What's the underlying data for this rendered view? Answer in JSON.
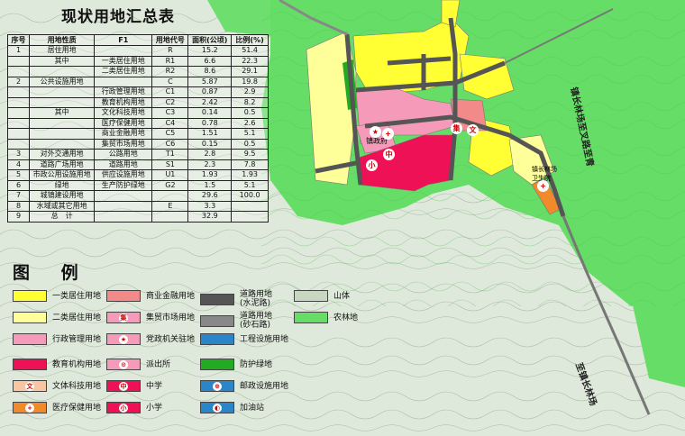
{
  "title": "现状用地汇总表",
  "table": {
    "headers": [
      "序号",
      "用地性质",
      "F1",
      "用地代号",
      "面积(公顷)",
      "比例(%)"
    ],
    "rows": [
      {
        "no": "1",
        "name": "居住用地",
        "sub": "",
        "code": "R",
        "area": "15.2",
        "ratio": "51.4"
      },
      {
        "no": "",
        "name": "其中",
        "sub": "一类居住用地",
        "code": "R1",
        "area": "6.6",
        "ratio": "22.3"
      },
      {
        "no": "",
        "name": "",
        "sub": "二类居住用地",
        "code": "R2",
        "area": "8.6",
        "ratio": "29.1"
      },
      {
        "no": "2",
        "name": "公共设施用地",
        "sub": "",
        "code": "C",
        "area": "5.87",
        "ratio": "19.8"
      },
      {
        "no": "",
        "name": "",
        "sub": "行政管理用地",
        "code": "C1",
        "area": "0.87",
        "ratio": "2.9"
      },
      {
        "no": "",
        "name": "",
        "sub": "教育机构用地",
        "code": "C2",
        "area": "2.42",
        "ratio": "8.2"
      },
      {
        "no": "",
        "name": "其中",
        "sub": "文化科技用地",
        "code": "C3",
        "area": "0.14",
        "ratio": "0.5"
      },
      {
        "no": "",
        "name": "",
        "sub": "医疗保健用地",
        "code": "C4",
        "area": "0.78",
        "ratio": "2.6"
      },
      {
        "no": "",
        "name": "",
        "sub": "商业金融用地",
        "code": "C5",
        "area": "1.51",
        "ratio": "5.1"
      },
      {
        "no": "",
        "name": "",
        "sub": "集贸市场用地",
        "code": "C6",
        "area": "0.15",
        "ratio": "0.5"
      },
      {
        "no": "3",
        "name": "对外交通用地",
        "sub": "公路用地",
        "code": "T1",
        "area": "2.8",
        "ratio": "9.5"
      },
      {
        "no": "4",
        "name": "道路广场用地",
        "sub": "道路用地",
        "code": "S1",
        "area": "2.3",
        "ratio": "7.8"
      },
      {
        "no": "5",
        "name": "市政公用设施用地",
        "sub": "供应设施用地",
        "code": "U1",
        "area": "1.93",
        "ratio": "1.93"
      },
      {
        "no": "6",
        "name": "绿地",
        "sub": "生产防护绿地",
        "code": "G2",
        "area": "1.5",
        "ratio": "5.1"
      },
      {
        "no": "7",
        "name": "城镇建设用地",
        "sub": "",
        "code": "",
        "area": "29.6",
        "ratio": "100.0"
      },
      {
        "no": "8",
        "name": "水域或其它用地",
        "sub": "",
        "code": "E",
        "area": "3.3",
        "ratio": ""
      },
      {
        "no": "9",
        "name": "总　计",
        "sub": "",
        "code": "",
        "area": "32.9",
        "ratio": ""
      }
    ]
  },
  "legend": {
    "title": "图 例",
    "items": [
      {
        "label": "一类居住用地",
        "color": "#ffff33",
        "glyph": ""
      },
      {
        "label": "二类居住用地",
        "color": "#ffff99",
        "glyph": ""
      },
      {
        "label": "行政管理用地",
        "color": "#f59ab8",
        "glyph": ""
      },
      {
        "label": "教育机构用地",
        "color": "#ee1155",
        "glyph": ""
      },
      {
        "label": "文体科技用地",
        "color": "#f8c6a0",
        "glyph": "文"
      },
      {
        "label": "医疗保健用地",
        "color": "#f08a2a",
        "glyph": "+"
      },
      {
        "label": "商业金融用地",
        "color": "#f28a8a",
        "glyph": ""
      },
      {
        "label": "集贸市场用地",
        "color": "#f59ab8",
        "glyph": "集"
      },
      {
        "label": "党政机关驻地",
        "color": "#f59ab8",
        "glyph": "★"
      },
      {
        "label": "派出所",
        "color": "#f59ab8",
        "glyph": "⊙"
      },
      {
        "label": "中学",
        "color": "#ee1155",
        "glyph": "中"
      },
      {
        "label": "小学",
        "color": "#ee1155",
        "glyph": "小"
      },
      {
        "label": "道路用地\n(水泥路)",
        "color": "#555555",
        "glyph": ""
      },
      {
        "label": "道路用地\n(砂石路)",
        "color": "#888888",
        "glyph": ""
      },
      {
        "label": "工程设施用地",
        "color": "#2a86c8",
        "glyph": ""
      },
      {
        "label": "防护绿地",
        "color": "#22aa22",
        "glyph": ""
      },
      {
        "label": "邮政设施用地",
        "color": "#2a86c8",
        "glyph": "⊕"
      },
      {
        "label": "加油站",
        "color": "#2a86c8",
        "glyph": "◐"
      },
      {
        "label": "山体",
        "color": "#c8d8c0",
        "glyph": ""
      },
      {
        "label": "农林地",
        "color": "#66dd66",
        "glyph": ""
      }
    ]
  },
  "map_labels": {
    "road_ne": "镇长林场至叉",
    "road_ne2": "路至青",
    "road_s": "至镇长林场",
    "gov": "镇政府",
    "hosp_label": "镇长林场\n卫生院",
    "market": "集",
    "wen": "文",
    "mid": "中",
    "prim": "小"
  },
  "colors": {
    "farmland": "#66dd66",
    "mountain": "#c7dcc3",
    "res1": "#ffff33",
    "res2": "#ffff99",
    "admin": "#f59ab8",
    "edu": "#ee1155",
    "road": "#555555"
  }
}
